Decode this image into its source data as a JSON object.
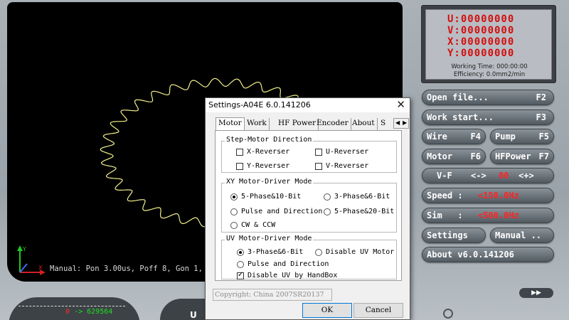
{
  "canvas": {
    "status_line": "Manual: Pon 3.00us, Poff 8, Gon 1,",
    "axis_labels": {
      "y": "Y",
      "x": "X"
    }
  },
  "coords": {
    "u": "U:00000000",
    "v": "V:00000000",
    "x": "X:00000000",
    "y": "Y:00000000",
    "working_time": "Working Time: 000:00:00",
    "efficiency": "Efficiency:  0.0mm2/min"
  },
  "buttons": {
    "open_file": {
      "label": "Open file...",
      "key": "F2"
    },
    "work_start": {
      "label": "Work start...",
      "key": "F3"
    },
    "wire": {
      "label": "Wire",
      "key": "F4"
    },
    "pump": {
      "label": "Pump",
      "key": "F5"
    },
    "motor": {
      "label": "Motor",
      "key": "F6"
    },
    "hfpower": {
      "label": "HFPower",
      "key": "F7"
    },
    "vf": {
      "label": "V-F",
      "dec": "<->",
      "value": "00",
      "inc": "<+>"
    },
    "speed": {
      "label": "Speed :",
      "value": "<150.0Hz"
    },
    "sim": {
      "label": "Sim   :",
      "value": "<500.0Hz"
    },
    "settings": {
      "label": "Settings"
    },
    "manual": {
      "label": "Manual .."
    },
    "about": {
      "label": "About v6.0.141206"
    },
    "nav": "▶▶"
  },
  "bottom": {
    "left_value_red": "0",
    "left_arrow": "->",
    "left_value_green": "629564",
    "mid_label": "U"
  },
  "dialog": {
    "title": "Settings-A04E   6.0.141206",
    "close": "✕",
    "tabs": [
      "Motor",
      "Work",
      "HF Power",
      "Encoder",
      "About",
      "S"
    ],
    "tab_arrows": [
      "◀",
      "▶"
    ],
    "step_motor": {
      "title": "Step-Motor Direction",
      "x_reverser": "X-Reverser",
      "u_reverser": "U-Reverser",
      "y_reverser": "Y-Reverser",
      "v_reverser": "V-Reverser"
    },
    "xy_driver": {
      "title": "XY Motor-Driver Mode",
      "opt1": "5-Phase&10-Bit",
      "opt2": "3-Phase&6-Bit",
      "opt3": "Pulse and Direction",
      "opt4": "5-Phase&20-Bit",
      "opt5": "CW & CCW",
      "selected": "5-Phase&10-Bit"
    },
    "uv_driver": {
      "title": "UV Motor-Driver Mode",
      "opt1": "3-Phase&6-Bit",
      "opt2": "Disable UV Motor",
      "opt3": "Pulse and Direction",
      "handbox": "Disable UV by HandBox",
      "selected": "3-Phase&6-Bit",
      "handbox_checked": true
    },
    "copyright": "Copyright: China 2007SR20137",
    "ok": "OK",
    "cancel": "Cancel"
  },
  "colors": {
    "coord_red": "#d30f0f",
    "plot_yellow": "#f3f08a",
    "value_red": "#ff2424"
  }
}
